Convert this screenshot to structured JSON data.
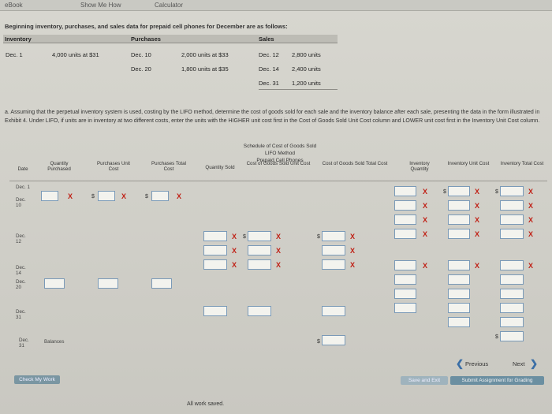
{
  "topbar": {
    "ebook": "eBook",
    "show_me_how": "Show Me How",
    "calculator": "Calculator"
  },
  "problem": {
    "title": "Beginning inventory, purchases, and sales data for prepaid cell phones for December are as follows:"
  },
  "data_table": {
    "headers": {
      "inventory": "Inventory",
      "purchases": "Purchases",
      "sales": "Sales"
    },
    "inventory_row": {
      "date": "Dec. 1",
      "qty": "4,000 units at $31"
    },
    "purchases": [
      {
        "date": "Dec. 10",
        "qty": "2,000 units at $33"
      },
      {
        "date": "Dec. 20",
        "qty": "1,800 units at $35"
      }
    ],
    "sales": [
      {
        "date": "Dec. 12",
        "qty": "2,800 units"
      },
      {
        "date": "Dec. 14",
        "qty": "2,400 units"
      },
      {
        "date": "Dec. 31",
        "qty": "1,200 units"
      }
    ]
  },
  "instructions": "a. Assuming that the perpetual inventory system is used, costing by the LIFO method, determine the cost of goods sold for each sale and the inventory balance after each sale, presenting the data in the form illustrated in Exhibit 4. Under LIFO, if units are in inventory at two different costs, enter the units with the HIGHER unit cost first in the Cost of Goods Sold Unit Cost column and LOWER unit cost first in the Inventory Unit Cost column.",
  "schedule": {
    "title1": "Schedule of Cost of Goods Sold",
    "title2": "LIFO Method",
    "title3": "Prepaid Cell Phones",
    "columns": {
      "date": "Date",
      "qty_purchased": "Quantity Purchased",
      "purch_unit_cost": "Purchases Unit Cost",
      "purch_total_cost": "Purchases Total Cost",
      "qty_sold": "Quantity Sold",
      "cogs_unit_cost": "Cost of Goods Sold Unit Cost",
      "cogs_total_cost": "Cost of Goods Sold Total Cost",
      "inv_qty": "Inventory Quantity",
      "inv_unit_cost": "Inventory Unit Cost",
      "inv_total_cost": "Inventory Total Cost"
    },
    "rows": {
      "dec1": "Dec. 1",
      "dec10": "Dec. 10",
      "dec12": "Dec. 12",
      "dec14": "Dec. 14",
      "dec20": "Dec. 20",
      "dec31": "Dec. 31",
      "dec31b": "Dec. 31",
      "balances": "Balances"
    },
    "cross_mark": "X",
    "dollar": "$"
  },
  "footer": {
    "check_my_work": "Check My Work",
    "saved_status": "All work saved.",
    "previous": "Previous",
    "next": "Next",
    "save_and_exit": "Save and Exit",
    "submit": "Submit Assignment for Grading"
  },
  "colors": {
    "error_mark": "#c02015",
    "input_border": "#7a9ab8",
    "accent": "#3a6ea6"
  }
}
